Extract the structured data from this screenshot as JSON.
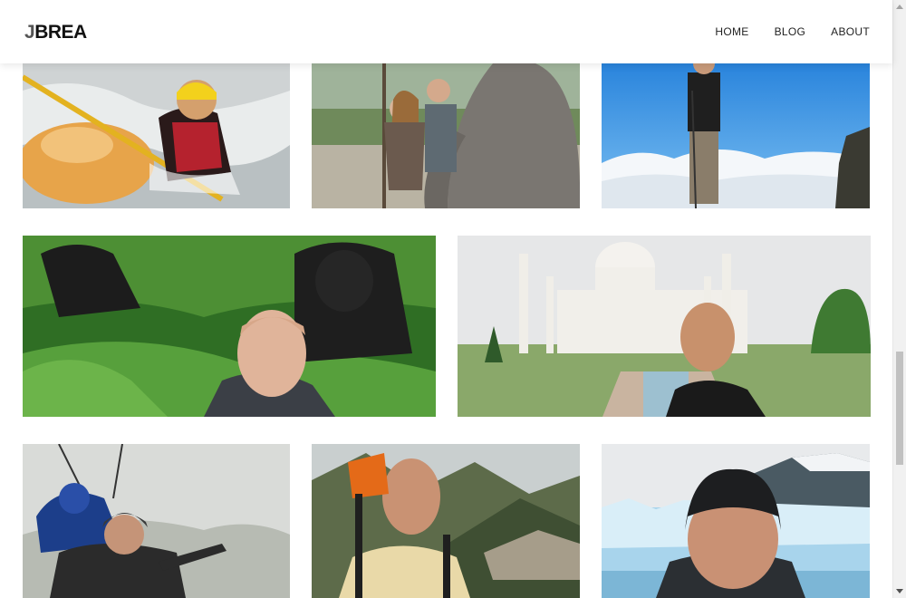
{
  "site": {
    "logo_first": "J",
    "logo_rest": "BREA"
  },
  "nav": {
    "items": [
      "HOME",
      "BLOG",
      "ABOUT"
    ]
  },
  "gallery": {
    "photos": [
      {
        "subject": "whitewater-kayaking"
      },
      {
        "subject": "couple-with-elephant"
      },
      {
        "subject": "hiker-above-clouds"
      },
      {
        "subject": "selfie-with-gorillas"
      },
      {
        "subject": "selfie-at-taj-mahal"
      },
      {
        "subject": "tandem-paragliding"
      },
      {
        "subject": "selfie-at-machu-picchu"
      },
      {
        "subject": "selfie-at-glacier"
      }
    ]
  },
  "colors": {
    "header_bg": "#ffffff",
    "text": "#222222",
    "page_bg": "#ffffff"
  }
}
